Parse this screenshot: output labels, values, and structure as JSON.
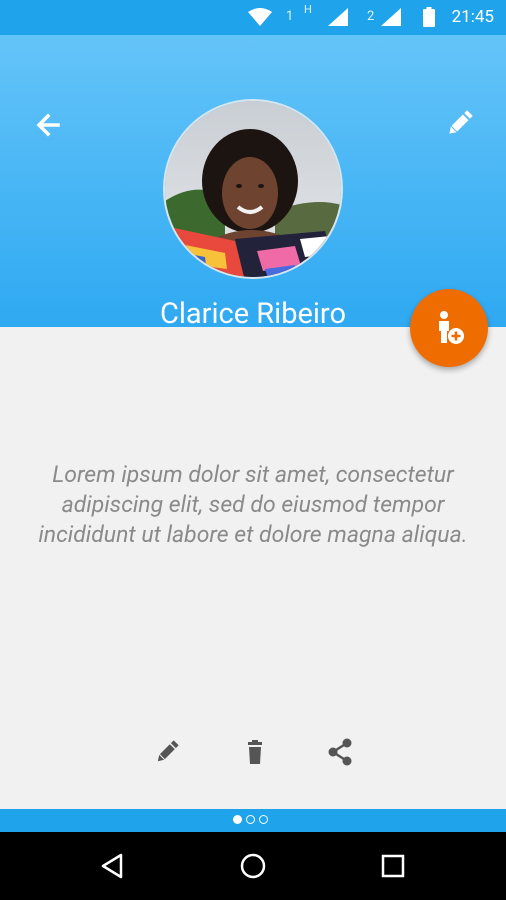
{
  "status_bar": {
    "time": "21:45",
    "sim1_label": "1",
    "sim1_network": "H",
    "sim2_label": "2",
    "icons": [
      "wifi-icon",
      "signal-icon",
      "signal-icon",
      "battery-icon"
    ]
  },
  "header": {
    "back_icon": "arrow-left-icon",
    "edit_icon": "pencil-icon",
    "name": "Clarice Ribeiro",
    "colors": {
      "gradient_top": "#64c4f8",
      "gradient_bottom": "#2fa9f2"
    }
  },
  "fab": {
    "icon": "add-person-icon",
    "color": "#ef6c00"
  },
  "content": {
    "description": "Lorem ipsum dolor sit amet, consectetur adipiscing elit, sed do eiusmod tempor incididunt ut labore et dolore magna aliqua."
  },
  "actions": [
    {
      "name": "edit",
      "icon": "pencil-icon"
    },
    {
      "name": "delete",
      "icon": "trash-icon"
    },
    {
      "name": "share",
      "icon": "share-icon"
    }
  ],
  "pager": {
    "pages": 3,
    "current": 1
  },
  "nav_bar": {
    "buttons": [
      "back-triangle-icon",
      "home-circle-icon",
      "recents-square-icon"
    ]
  }
}
